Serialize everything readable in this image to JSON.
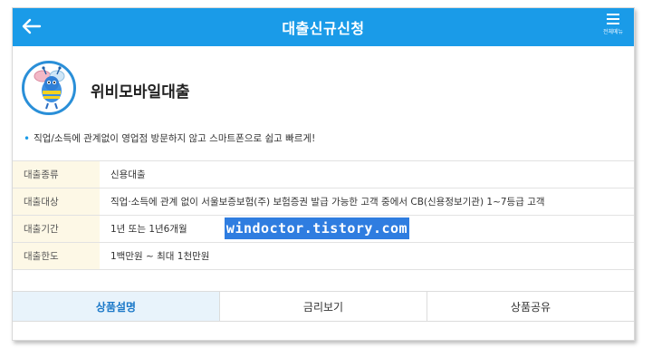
{
  "header": {
    "title": "대출신규신청",
    "menu_label": "전체메뉴",
    "back_icon": "arrow-left-icon",
    "menu_icon": "hamburger-icon",
    "color": "#1a9be8"
  },
  "product": {
    "name": "위비모바일대출",
    "logo_icon": "wibee-mascot-icon",
    "description": "직업/소득에 관계없이 영업점 방문하지 않고 스마트폰으로 쉽고 빠르게!"
  },
  "info": [
    {
      "label": "대출종류",
      "value": "신용대출"
    },
    {
      "label": "대출대상",
      "value": "직업·소득에 관계 없이 서울보증보험(주) 보험증권 발급 가능한 고객 중에서 CB(신용정보기관) 1~7등급 고객"
    },
    {
      "label": "대출기간",
      "value": "1년 또는 1년6개월"
    },
    {
      "label": "대출한도",
      "value": "1백만원 ~ 최대 1천만원"
    }
  ],
  "tabs": [
    {
      "label": "상품설명",
      "active": true
    },
    {
      "label": "금리보기",
      "active": false
    },
    {
      "label": "상품공유",
      "active": false
    }
  ],
  "watermark": "windoctor.tistory.com"
}
